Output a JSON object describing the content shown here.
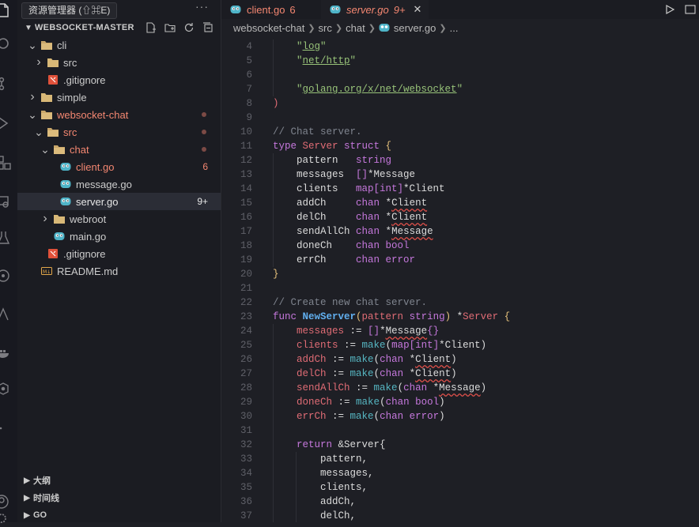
{
  "tooltip": "资源管理器 (⇧⌘E)",
  "explorer": {
    "title": "WEBSOCKET-MASTER",
    "tree": [
      {
        "label": "cli",
        "type": "folder",
        "open": true,
        "depth": 1,
        "color": "normal"
      },
      {
        "label": "src",
        "type": "folder",
        "open": false,
        "depth": 2,
        "color": "normal"
      },
      {
        "label": ".gitignore",
        "type": "git",
        "depth": 2,
        "color": "normal"
      },
      {
        "label": "simple",
        "type": "folder",
        "open": false,
        "depth": 1,
        "color": "normal"
      },
      {
        "label": "websocket-chat",
        "type": "folder",
        "open": true,
        "depth": 1,
        "color": "err",
        "dot": true
      },
      {
        "label": "src",
        "type": "folder",
        "open": true,
        "depth": 2,
        "color": "err",
        "dot": true
      },
      {
        "label": "chat",
        "type": "folder",
        "open": true,
        "depth": 3,
        "color": "err",
        "dot": true
      },
      {
        "label": "client.go",
        "type": "go",
        "depth": 4,
        "color": "err",
        "badge": "6"
      },
      {
        "label": "message.go",
        "type": "go",
        "depth": 4,
        "color": "normal"
      },
      {
        "label": "server.go",
        "type": "go",
        "depth": 4,
        "color": "white",
        "badge": "9+",
        "selected": true
      },
      {
        "label": "webroot",
        "type": "folder",
        "open": false,
        "depth": 3,
        "color": "normal"
      },
      {
        "label": "main.go",
        "type": "go",
        "depth": 3,
        "color": "normal"
      },
      {
        "label": ".gitignore",
        "type": "git",
        "depth": 2,
        "color": "normal"
      },
      {
        "label": "README.md",
        "type": "md",
        "depth": 1,
        "color": "normal"
      }
    ],
    "bottom_sections": [
      "大纲",
      "时间线",
      "GO"
    ]
  },
  "tabs": [
    {
      "label": "client.go",
      "badge": "6",
      "active": false
    },
    {
      "label": "server.go",
      "badge": "9+",
      "active": true
    }
  ],
  "breadcrumb": [
    "websocket-chat",
    "src",
    "chat",
    "server.go",
    "..."
  ],
  "code": {
    "lines": [
      {
        "n": "4",
        "tokens": [
          [
            "    ",
            ""
          ],
          [
            "\"",
            "str"
          ],
          [
            "log",
            "strl"
          ],
          [
            "\"",
            "str"
          ]
        ]
      },
      {
        "n": "5",
        "tokens": [
          [
            "    ",
            ""
          ],
          [
            "\"",
            "str"
          ],
          [
            "net/http",
            "strl"
          ],
          [
            "\"",
            "str"
          ]
        ]
      },
      {
        "n": "6",
        "tokens": []
      },
      {
        "n": "7",
        "tokens": [
          [
            "    ",
            ""
          ],
          [
            "\"",
            "str"
          ],
          [
            "golang.org/x/net/websocket",
            "strl"
          ],
          [
            "\"",
            "str"
          ]
        ]
      },
      {
        "n": "8",
        "tokens": [
          [
            ")",
            "fld"
          ]
        ]
      },
      {
        "n": "9",
        "tokens": []
      },
      {
        "n": "10",
        "tokens": [
          [
            "// Chat server.",
            "cm"
          ]
        ]
      },
      {
        "n": "11",
        "tokens": [
          [
            "type ",
            "kw"
          ],
          [
            "Server ",
            "fld"
          ],
          [
            "struct ",
            "kw"
          ],
          [
            "{",
            "ty"
          ]
        ]
      },
      {
        "n": "12",
        "tokens": [
          [
            "    pattern   ",
            "id"
          ],
          [
            "string",
            "kw"
          ]
        ]
      },
      {
        "n": "13",
        "tokens": [
          [
            "    messages  ",
            "id"
          ],
          [
            "[]",
            "kw"
          ],
          [
            "*Message",
            "id"
          ]
        ]
      },
      {
        "n": "14",
        "tokens": [
          [
            "    clients   ",
            "id"
          ],
          [
            "map[int]",
            "kw"
          ],
          [
            "*Client",
            "id"
          ]
        ]
      },
      {
        "n": "15",
        "tokens": [
          [
            "    addCh     ",
            "id"
          ],
          [
            "chan ",
            "kw"
          ],
          [
            "*",
            "id"
          ],
          [
            "Client",
            "id sq"
          ]
        ]
      },
      {
        "n": "16",
        "tokens": [
          [
            "    delCh     ",
            "id"
          ],
          [
            "chan ",
            "kw"
          ],
          [
            "*",
            "id"
          ],
          [
            "Client",
            "id sq"
          ]
        ]
      },
      {
        "n": "17",
        "tokens": [
          [
            "    sendAllCh ",
            "id"
          ],
          [
            "chan ",
            "kw"
          ],
          [
            "*",
            "id"
          ],
          [
            "Message",
            "id sq"
          ]
        ]
      },
      {
        "n": "18",
        "tokens": [
          [
            "    doneCh    ",
            "id"
          ],
          [
            "chan bool",
            "kw"
          ]
        ]
      },
      {
        "n": "19",
        "tokens": [
          [
            "    errCh     ",
            "id"
          ],
          [
            "chan error",
            "kw"
          ]
        ]
      },
      {
        "n": "20",
        "tokens": [
          [
            "}",
            "ty"
          ]
        ]
      },
      {
        "n": "21",
        "tokens": []
      },
      {
        "n": "22",
        "tokens": [
          [
            "// Create new chat server.",
            "cm"
          ]
        ]
      },
      {
        "n": "23",
        "tokens": [
          [
            "func ",
            "kw"
          ],
          [
            "NewServer",
            "fn"
          ],
          [
            "(",
            "ty"
          ],
          [
            "pattern ",
            "fld"
          ],
          [
            "string",
            "kw"
          ],
          [
            ") ",
            "ty"
          ],
          [
            "*",
            "id"
          ],
          [
            "Server ",
            "fld"
          ],
          [
            "{",
            "ty"
          ]
        ]
      },
      {
        "n": "24",
        "tokens": [
          [
            "    ",
            ""
          ],
          [
            "messages",
            "fld"
          ],
          [
            " := ",
            "id"
          ],
          [
            "[]",
            "kw"
          ],
          [
            "*",
            "id"
          ],
          [
            "Message",
            "id sq"
          ],
          [
            "{}",
            "kw"
          ]
        ]
      },
      {
        "n": "25",
        "tokens": [
          [
            "    ",
            ""
          ],
          [
            "clients",
            "fld"
          ],
          [
            " := ",
            "id"
          ],
          [
            "make",
            "bi"
          ],
          [
            "(",
            "id"
          ],
          [
            "map[int]",
            "kw"
          ],
          [
            "*Client",
            "id"
          ],
          [
            ")",
            "id"
          ]
        ]
      },
      {
        "n": "26",
        "tokens": [
          [
            "    ",
            ""
          ],
          [
            "addCh",
            "fld"
          ],
          [
            " := ",
            "id"
          ],
          [
            "make",
            "bi"
          ],
          [
            "(",
            "id"
          ],
          [
            "chan ",
            "kw"
          ],
          [
            "*",
            "id"
          ],
          [
            "Client",
            "id sq"
          ],
          [
            ")",
            "id"
          ]
        ]
      },
      {
        "n": "27",
        "tokens": [
          [
            "    ",
            ""
          ],
          [
            "delCh",
            "fld"
          ],
          [
            " := ",
            "id"
          ],
          [
            "make",
            "bi"
          ],
          [
            "(",
            "id"
          ],
          [
            "chan ",
            "kw"
          ],
          [
            "*",
            "id"
          ],
          [
            "Client",
            "id sq"
          ],
          [
            ")",
            "id"
          ]
        ]
      },
      {
        "n": "28",
        "tokens": [
          [
            "    ",
            ""
          ],
          [
            "sendAllCh",
            "fld"
          ],
          [
            " := ",
            "id"
          ],
          [
            "make",
            "bi"
          ],
          [
            "(",
            "id"
          ],
          [
            "chan ",
            "kw"
          ],
          [
            "*",
            "id"
          ],
          [
            "Message",
            "id sq"
          ],
          [
            ")",
            "id"
          ]
        ]
      },
      {
        "n": "29",
        "tokens": [
          [
            "    ",
            ""
          ],
          [
            "doneCh",
            "fld"
          ],
          [
            " := ",
            "id"
          ],
          [
            "make",
            "bi"
          ],
          [
            "(",
            "id"
          ],
          [
            "chan bool",
            "kw"
          ],
          [
            ")",
            "id"
          ]
        ]
      },
      {
        "n": "30",
        "tokens": [
          [
            "    ",
            ""
          ],
          [
            "errCh",
            "fld"
          ],
          [
            " := ",
            "id"
          ],
          [
            "make",
            "bi"
          ],
          [
            "(",
            "id"
          ],
          [
            "chan error",
            "kw"
          ],
          [
            ")",
            "id"
          ]
        ]
      },
      {
        "n": "31",
        "tokens": []
      },
      {
        "n": "32",
        "tokens": [
          [
            "    ",
            ""
          ],
          [
            "return ",
            "kw"
          ],
          [
            "&Server{",
            "id"
          ]
        ]
      },
      {
        "n": "33",
        "tokens": [
          [
            "        pattern,",
            "id"
          ]
        ]
      },
      {
        "n": "34",
        "tokens": [
          [
            "        messages,",
            "id"
          ]
        ]
      },
      {
        "n": "35",
        "tokens": [
          [
            "        clients,",
            "id"
          ]
        ]
      },
      {
        "n": "36",
        "tokens": [
          [
            "        addCh,",
            "id"
          ]
        ]
      },
      {
        "n": "37",
        "tokens": [
          [
            "        delCh,",
            "id"
          ]
        ]
      }
    ]
  },
  "colors": {
    "error": "#f48771",
    "accent": "#e2a74a",
    "background": "#1e1f25"
  }
}
